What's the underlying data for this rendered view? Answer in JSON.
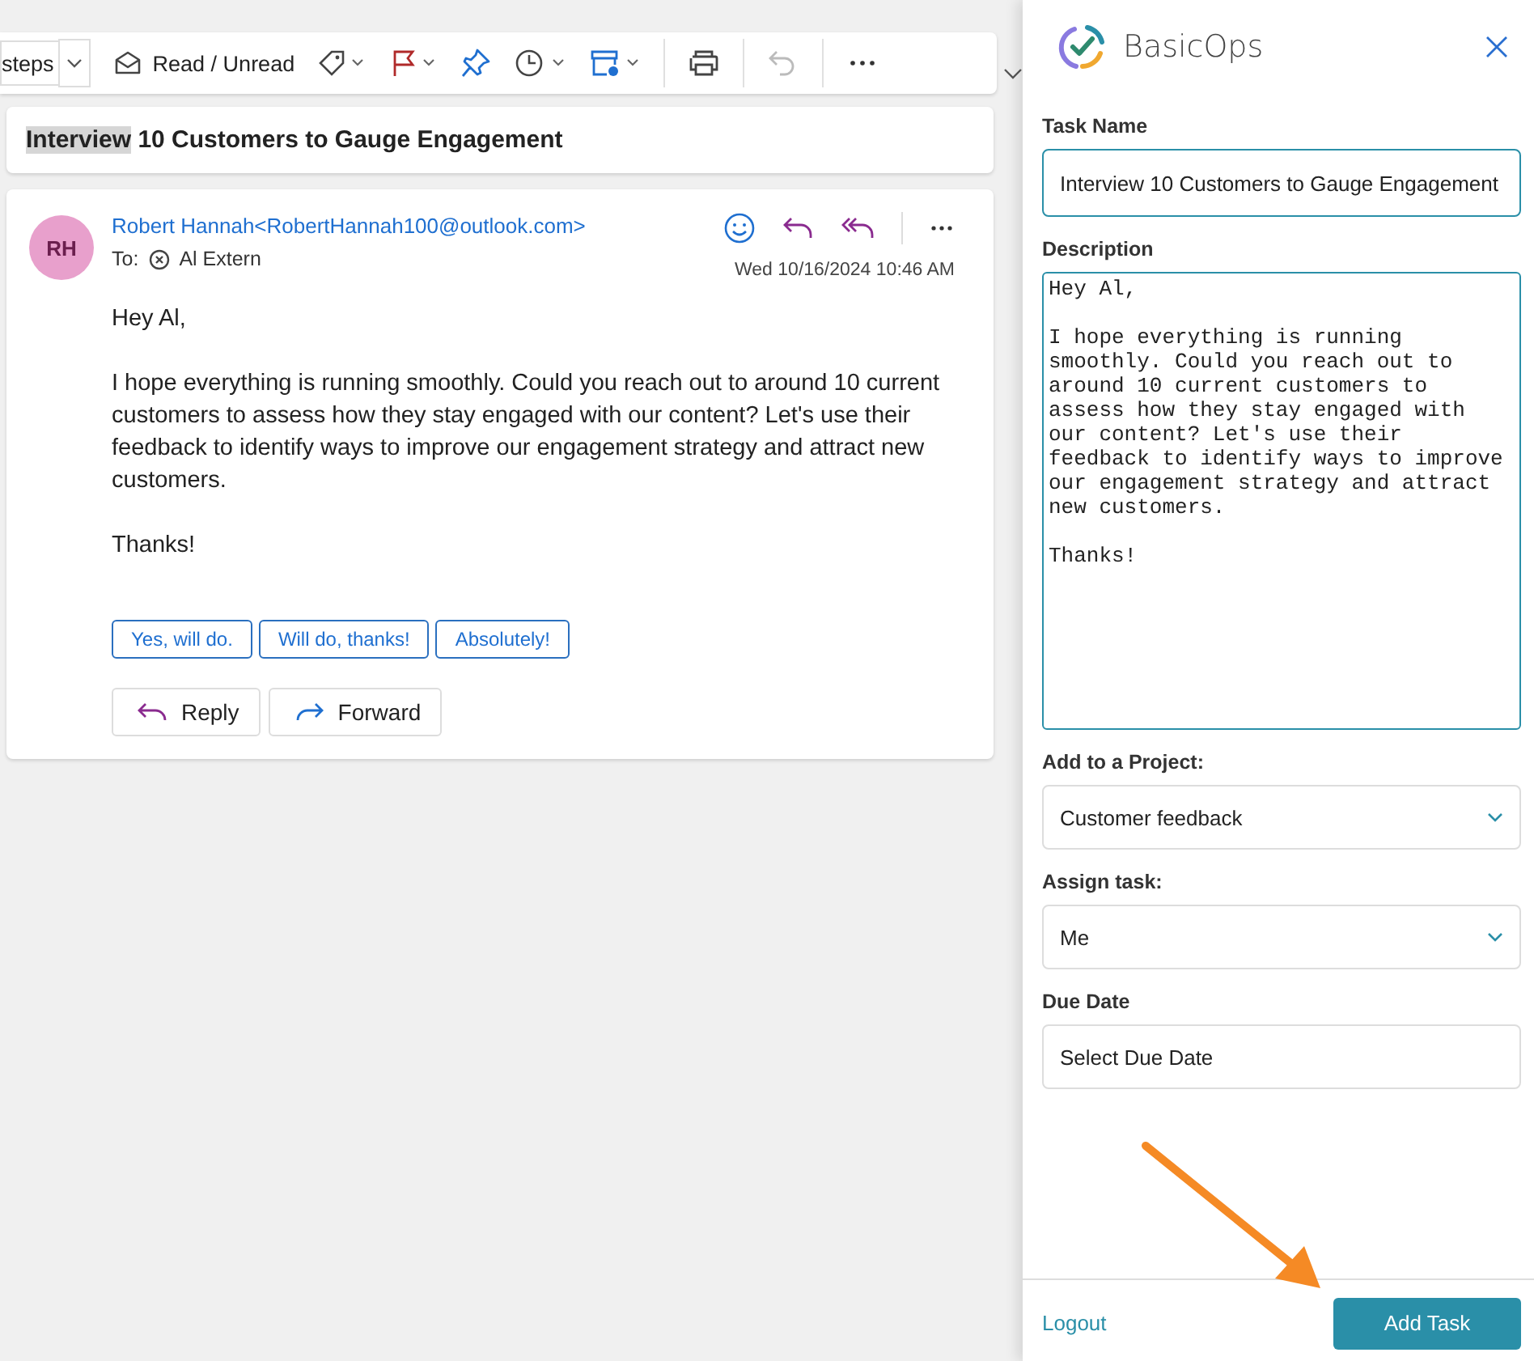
{
  "toolbar": {
    "steps_label": "steps",
    "read_unread": "Read / Unread"
  },
  "subject": [
    {
      "text": "Interview",
      "highlighted": true
    },
    {
      "text": " 10 Customers to Gauge Engagement",
      "highlighted": false
    }
  ],
  "email": {
    "avatar": "RH",
    "sender": "Robert Hannah<RobertHannah100@outlook.com>",
    "to_label": "To:",
    "recipient": "Al Extern",
    "date": "Wed 10/16/2024 10:46 AM",
    "body": [
      "Hey Al,",
      "I hope everything is running smoothly. Could you reach out to around 10 current customers to assess how they stay engaged with our content? Let's use their feedback to identify ways to improve our engagement strategy and attract new customers.",
      "Thanks!"
    ],
    "suggested_replies": [
      "Yes, will do.",
      "Will do, thanks!",
      "Absolutely!"
    ],
    "actions": [
      {
        "kind": "reply",
        "label": "Reply"
      },
      {
        "kind": "forward",
        "label": "Forward"
      }
    ]
  },
  "panel": {
    "brand": "BasicOps",
    "fields": [
      {
        "kind": "text",
        "label": "Task Name",
        "value": "Interview 10 Customers to Gauge Engagement"
      },
      {
        "kind": "textarea",
        "label": "Description",
        "value": "Hey Al,\n\nI hope everything is running smoothly. Could you reach out to around 10 current customers to assess how they stay engaged with our content? Let's use their feedback to identify ways to improve our engagement strategy and attract new customers.\n\nThanks!"
      },
      {
        "kind": "select",
        "label": "Add to a Project:",
        "value": "Customer feedback"
      },
      {
        "kind": "select",
        "label": "Assign task:",
        "value": "Me"
      },
      {
        "kind": "date",
        "label": "Due Date",
        "placeholder": "Select Due Date"
      }
    ],
    "logout": "Logout",
    "submit": "Add Task"
  }
}
